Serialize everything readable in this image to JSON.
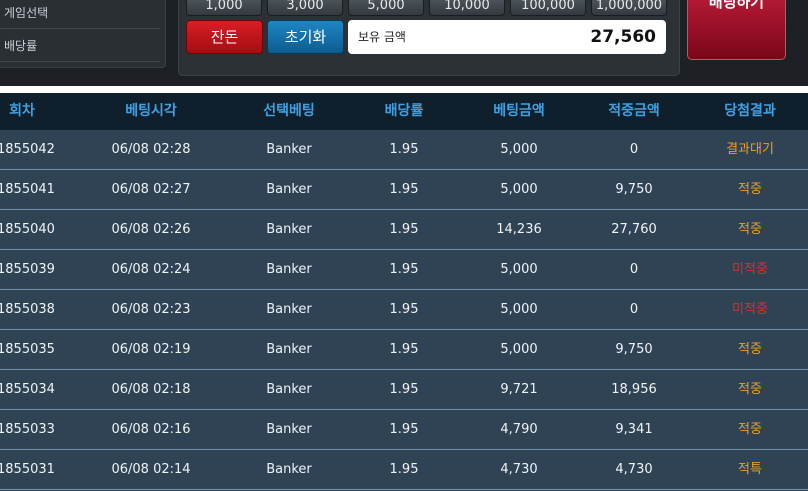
{
  "info": {
    "game_select": "게임선택",
    "payout_rate": "배당률"
  },
  "chips": [
    "1,000",
    "3,000",
    "5,000",
    "10,000",
    "100,000",
    "1,000,000"
  ],
  "buttons": {
    "change": "잔돈",
    "reset": "초기화",
    "place_bet": "배팅하기"
  },
  "balance": {
    "label": "보유 금액",
    "amount": "27,560"
  },
  "table": {
    "headers": [
      "회차",
      "베팅시각",
      "선택베팅",
      "배당률",
      "베팅금액",
      "적중금액",
      "당첨결과"
    ],
    "rows": [
      {
        "round": "1855042",
        "time": "06/08 02:28",
        "pick": "Banker",
        "odds": "1.95",
        "bet": "5,000",
        "win": "0",
        "result": "결과대기",
        "status": "wait"
      },
      {
        "round": "1855041",
        "time": "06/08 02:27",
        "pick": "Banker",
        "odds": "1.95",
        "bet": "5,000",
        "win": "9,750",
        "result": "적중",
        "status": "hit"
      },
      {
        "round": "1855040",
        "time": "06/08 02:26",
        "pick": "Banker",
        "odds": "1.95",
        "bet": "14,236",
        "win": "27,760",
        "result": "적중",
        "status": "hit"
      },
      {
        "round": "1855039",
        "time": "06/08 02:24",
        "pick": "Banker",
        "odds": "1.95",
        "bet": "5,000",
        "win": "0",
        "result": "미적중",
        "status": "miss"
      },
      {
        "round": "1855038",
        "time": "06/08 02:23",
        "pick": "Banker",
        "odds": "1.95",
        "bet": "5,000",
        "win": "0",
        "result": "미적중",
        "status": "miss"
      },
      {
        "round": "1855035",
        "time": "06/08 02:19",
        "pick": "Banker",
        "odds": "1.95",
        "bet": "5,000",
        "win": "9,750",
        "result": "적중",
        "status": "hit"
      },
      {
        "round": "1855034",
        "time": "06/08 02:18",
        "pick": "Banker",
        "odds": "1.95",
        "bet": "9,721",
        "win": "18,956",
        "result": "적중",
        "status": "hit"
      },
      {
        "round": "1855033",
        "time": "06/08 02:16",
        "pick": "Banker",
        "odds": "1.95",
        "bet": "4,790",
        "win": "9,341",
        "result": "적중",
        "status": "hit"
      },
      {
        "round": "1855031",
        "time": "06/08 02:14",
        "pick": "Banker",
        "odds": "1.95",
        "bet": "4,730",
        "win": "4,730",
        "result": "적특",
        "status": "hit"
      }
    ]
  },
  "colors": {
    "header_text": "#3fa1e3",
    "row_bg": "#2f4355",
    "result_hit": "#f39c24",
    "result_miss": "#e02c2c"
  }
}
